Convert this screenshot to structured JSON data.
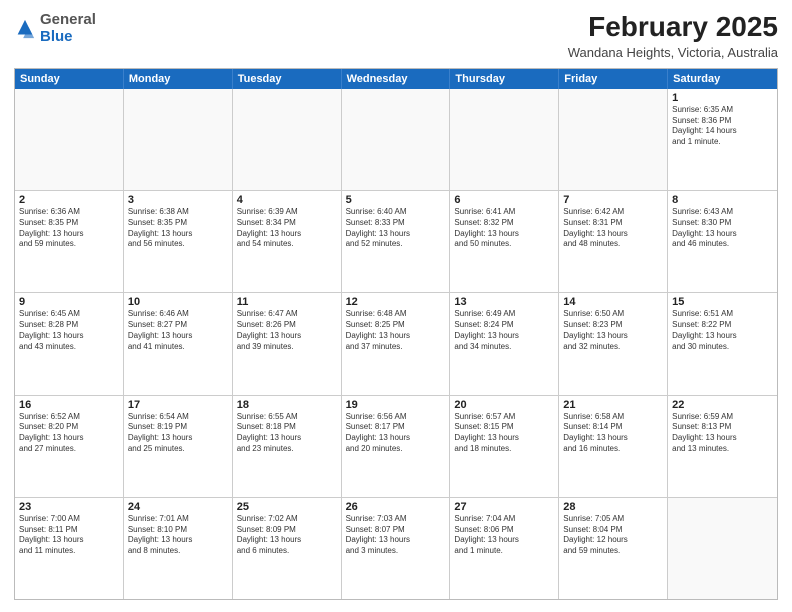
{
  "logo": {
    "general": "General",
    "blue": "Blue"
  },
  "title": "February 2025",
  "location": "Wandana Heights, Victoria, Australia",
  "days": [
    "Sunday",
    "Monday",
    "Tuesday",
    "Wednesday",
    "Thursday",
    "Friday",
    "Saturday"
  ],
  "weeks": [
    [
      {
        "day": "",
        "info": ""
      },
      {
        "day": "",
        "info": ""
      },
      {
        "day": "",
        "info": ""
      },
      {
        "day": "",
        "info": ""
      },
      {
        "day": "",
        "info": ""
      },
      {
        "day": "",
        "info": ""
      },
      {
        "day": "1",
        "info": "Sunrise: 6:35 AM\nSunset: 8:36 PM\nDaylight: 14 hours\nand 1 minute."
      }
    ],
    [
      {
        "day": "2",
        "info": "Sunrise: 6:36 AM\nSunset: 8:35 PM\nDaylight: 13 hours\nand 59 minutes."
      },
      {
        "day": "3",
        "info": "Sunrise: 6:38 AM\nSunset: 8:35 PM\nDaylight: 13 hours\nand 56 minutes."
      },
      {
        "day": "4",
        "info": "Sunrise: 6:39 AM\nSunset: 8:34 PM\nDaylight: 13 hours\nand 54 minutes."
      },
      {
        "day": "5",
        "info": "Sunrise: 6:40 AM\nSunset: 8:33 PM\nDaylight: 13 hours\nand 52 minutes."
      },
      {
        "day": "6",
        "info": "Sunrise: 6:41 AM\nSunset: 8:32 PM\nDaylight: 13 hours\nand 50 minutes."
      },
      {
        "day": "7",
        "info": "Sunrise: 6:42 AM\nSunset: 8:31 PM\nDaylight: 13 hours\nand 48 minutes."
      },
      {
        "day": "8",
        "info": "Sunrise: 6:43 AM\nSunset: 8:30 PM\nDaylight: 13 hours\nand 46 minutes."
      }
    ],
    [
      {
        "day": "9",
        "info": "Sunrise: 6:45 AM\nSunset: 8:28 PM\nDaylight: 13 hours\nand 43 minutes."
      },
      {
        "day": "10",
        "info": "Sunrise: 6:46 AM\nSunset: 8:27 PM\nDaylight: 13 hours\nand 41 minutes."
      },
      {
        "day": "11",
        "info": "Sunrise: 6:47 AM\nSunset: 8:26 PM\nDaylight: 13 hours\nand 39 minutes."
      },
      {
        "day": "12",
        "info": "Sunrise: 6:48 AM\nSunset: 8:25 PM\nDaylight: 13 hours\nand 37 minutes."
      },
      {
        "day": "13",
        "info": "Sunrise: 6:49 AM\nSunset: 8:24 PM\nDaylight: 13 hours\nand 34 minutes."
      },
      {
        "day": "14",
        "info": "Sunrise: 6:50 AM\nSunset: 8:23 PM\nDaylight: 13 hours\nand 32 minutes."
      },
      {
        "day": "15",
        "info": "Sunrise: 6:51 AM\nSunset: 8:22 PM\nDaylight: 13 hours\nand 30 minutes."
      }
    ],
    [
      {
        "day": "16",
        "info": "Sunrise: 6:52 AM\nSunset: 8:20 PM\nDaylight: 13 hours\nand 27 minutes."
      },
      {
        "day": "17",
        "info": "Sunrise: 6:54 AM\nSunset: 8:19 PM\nDaylight: 13 hours\nand 25 minutes."
      },
      {
        "day": "18",
        "info": "Sunrise: 6:55 AM\nSunset: 8:18 PM\nDaylight: 13 hours\nand 23 minutes."
      },
      {
        "day": "19",
        "info": "Sunrise: 6:56 AM\nSunset: 8:17 PM\nDaylight: 13 hours\nand 20 minutes."
      },
      {
        "day": "20",
        "info": "Sunrise: 6:57 AM\nSunset: 8:15 PM\nDaylight: 13 hours\nand 18 minutes."
      },
      {
        "day": "21",
        "info": "Sunrise: 6:58 AM\nSunset: 8:14 PM\nDaylight: 13 hours\nand 16 minutes."
      },
      {
        "day": "22",
        "info": "Sunrise: 6:59 AM\nSunset: 8:13 PM\nDaylight: 13 hours\nand 13 minutes."
      }
    ],
    [
      {
        "day": "23",
        "info": "Sunrise: 7:00 AM\nSunset: 8:11 PM\nDaylight: 13 hours\nand 11 minutes."
      },
      {
        "day": "24",
        "info": "Sunrise: 7:01 AM\nSunset: 8:10 PM\nDaylight: 13 hours\nand 8 minutes."
      },
      {
        "day": "25",
        "info": "Sunrise: 7:02 AM\nSunset: 8:09 PM\nDaylight: 13 hours\nand 6 minutes."
      },
      {
        "day": "26",
        "info": "Sunrise: 7:03 AM\nSunset: 8:07 PM\nDaylight: 13 hours\nand 3 minutes."
      },
      {
        "day": "27",
        "info": "Sunrise: 7:04 AM\nSunset: 8:06 PM\nDaylight: 13 hours\nand 1 minute."
      },
      {
        "day": "28",
        "info": "Sunrise: 7:05 AM\nSunset: 8:04 PM\nDaylight: 12 hours\nand 59 minutes."
      },
      {
        "day": "",
        "info": ""
      }
    ]
  ]
}
